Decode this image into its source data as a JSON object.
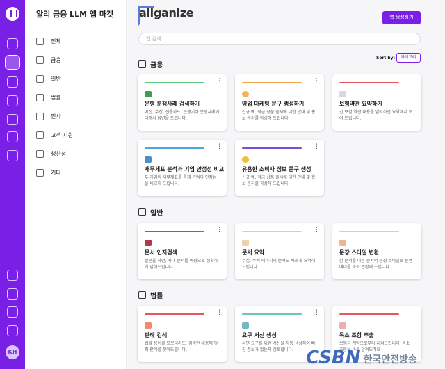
{
  "app": {
    "brand": "allganize",
    "avatar_initials": "KH"
  },
  "sidebar": {
    "title": "알리 금융 LLM 앱 마켓",
    "items": [
      {
        "label": "전체",
        "icon": "shapes-icon"
      },
      {
        "label": "금융",
        "icon": "bank-icon"
      },
      {
        "label": "일반",
        "icon": "briefcase-icon"
      },
      {
        "label": "법률",
        "icon": "gavel-icon"
      },
      {
        "label": "인사",
        "icon": "handshake-icon"
      },
      {
        "label": "고객 지원",
        "icon": "line-chart-icon"
      },
      {
        "label": "생산성",
        "icon": "bar-chart-icon"
      },
      {
        "label": "기타",
        "icon": "grid-icon"
      }
    ]
  },
  "header": {
    "create_button": "앱 생성하기",
    "search_placeholder": "앱 검색..",
    "sort_label": "Sort by:",
    "sort_value": "카테고리"
  },
  "sections": [
    {
      "title": "금융",
      "icon": "bank-icon",
      "cards": [
        {
          "title": "은행 분쟁사례 검색하기",
          "desc": "예신, 수신, 신용카드, 은행기타 분쟁사례에 대해서 답변을 드립니다.",
          "color": "#5ac77a"
        },
        {
          "title": "영업 마케팅 문구 생성하기",
          "desc": "신규 예, 적금 상품 출시에 대한 안내 및 홍보 문자를 작성해 드립니다.",
          "color": "#f0a648"
        },
        {
          "title": "보험약관 요약하기",
          "desc": "긴 보험 약관 내용을 입력하면 요약해서 보여 드립니다.",
          "color": "#e8555e"
        },
        {
          "title": "재무제표 분석과 기업 안정성 비교",
          "desc": "두 기업의 재무제표를 통해 기업의 안정성을 비교해 드립니다.",
          "color": "#4aa8e0"
        },
        {
          "title": "유용한 소비자 정보 문구 생성",
          "desc": "신규 예, 적금 상품 출시에 대한 안내 및 홍보 문자를 작성해 드립니다.",
          "color": "#7a4fd6"
        }
      ]
    },
    {
      "title": "일반",
      "icon": "briefcase-icon",
      "cards": [
        {
          "title": "문서 인지검색",
          "desc": "질문을 하면, 사내 문서를 바탕으로 정확하게 답해드립니다.",
          "color": "#c9485b"
        },
        {
          "title": "문서 요약",
          "desc": "수십, 수백 페이지의 문서도 빠르게 요약해 드립니다.",
          "color": "#e8c9b8"
        },
        {
          "title": "문장 스타일 변환",
          "desc": "한 문서를 다른 문서의 문장 스타일로 톤앤매너를 바로 변환해 드립니다.",
          "color": "#f0c6a8"
        }
      ]
    },
    {
      "title": "법률",
      "icon": "gavel-icon",
      "cards": [
        {
          "title": "판례 검색",
          "desc": "법률 용어를 모르더라도, 검색한 내용에 맞춰 판례를 찾아드립니다.",
          "color": "#e8555e"
        },
        {
          "title": "요구 서신 생성",
          "desc": "서면 요구를 위한 서신을 자동 생성하여 빠진 정보가 없는지 검토합니다.",
          "color": "#6fc4b8"
        },
        {
          "title": "독소 조항 추출",
          "desc": "보험금 계약으로부터 지켜드립니다. 독소 조항을 바로 알려드려요",
          "color": "#e8555e"
        }
      ]
    }
  ],
  "watermark": {
    "logo": "CSBN",
    "text": "한국안전방송"
  }
}
